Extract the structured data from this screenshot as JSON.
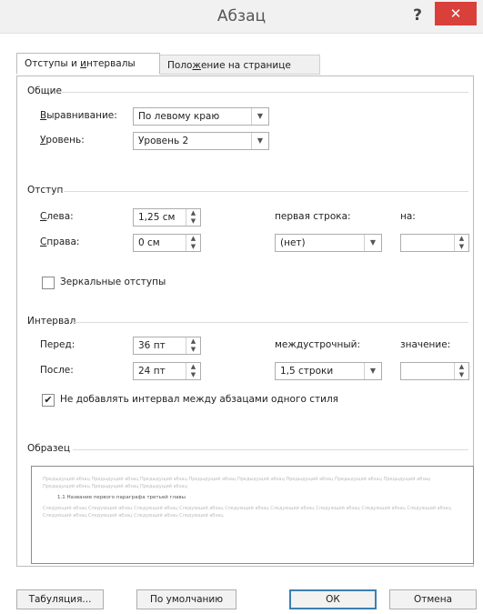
{
  "window": {
    "title": "Абзац",
    "help": "?",
    "close": "✕"
  },
  "tabs": [
    {
      "label_pre": "Отступы и ",
      "label_hot": "и",
      "label_post": "нтервалы"
    },
    {
      "label_pre": "Поло",
      "label_hot": "ж",
      "label_post": "ение на странице"
    }
  ],
  "general": {
    "title": "Общие",
    "alignment_label_hot": "В",
    "alignment_label_rest": "ыравнивание:",
    "alignment_value": "По левому краю",
    "level_label_hot": "У",
    "level_label_rest": "ровень:",
    "level_value": "Уровень 2"
  },
  "indent": {
    "title": "Отступ",
    "left_label_hot": "С",
    "left_label_rest": "лева:",
    "left_value": "1,25 см",
    "right_label_hot": "С",
    "right_label_rest": "права:",
    "right_value": "0 см",
    "first_line_label": "первая строка:",
    "first_line_value": "(нет)",
    "by_label": "на:",
    "by_value": "",
    "mirror_label": "Зеркальные отступы",
    "mirror_checked": false
  },
  "spacing": {
    "title": "Интервал",
    "before_label": "Перед:",
    "before_value": "36 пт",
    "after_label": "После:",
    "after_value": "24 пт",
    "line_spacing_label": "междустрочный:",
    "line_spacing_value": "1,5 строки",
    "value_label": "значение:",
    "value_value": "",
    "no_space_label": "Не добавлять интервал между абзацами одного стиля",
    "no_space_checked": true
  },
  "sample": {
    "title": "Образец",
    "prev_text": "Предыдущий абзац Предыдущий абзац Предыдущий абзац Предыдущий абзац Предыдущий абзац Предыдущий абзац Предыдущий абзац Предыдущий абзац Предыдущий абзац Предыдущий абзац Предыдущий абзац",
    "current_text": "1.1 Название первого параграфа третьей главы",
    "next_text": "Следующий абзац Следующий абзац Следующий абзац Следующий абзац Следующий абзац Следующий абзац Следующий абзац Следующий абзац Следующий абзац Следующий абзац Следующий абзац Следующий абзац Следующий абзац"
  },
  "buttons": {
    "tabs": "Табуляция...",
    "default": "По умолчанию",
    "ok": "ОК",
    "cancel": "Отмена"
  }
}
